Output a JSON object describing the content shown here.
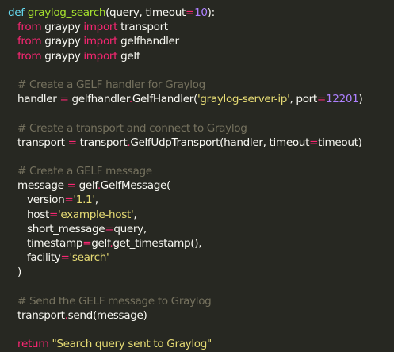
{
  "code": {
    "language": "python",
    "colors": {
      "background": "#272822",
      "text": "#f8f8f2",
      "keyword_def": "#66d9ef",
      "keyword_import": "#f92672",
      "function_name": "#a6e22e",
      "number": "#ae81ff",
      "string": "#e6db74",
      "comment": "#75715e",
      "operator": "#f92672"
    },
    "lines": [
      [
        {
          "t": "def",
          "c": "kw"
        },
        {
          "t": " ",
          "c": "plain"
        },
        {
          "t": "graylog_search",
          "c": "fn"
        },
        {
          "t": "(query, timeout",
          "c": "plain"
        },
        {
          "t": "=",
          "c": "op"
        },
        {
          "t": "10",
          "c": "num"
        },
        {
          "t": "):",
          "c": "plain"
        }
      ],
      [
        {
          "t": "from",
          "c": "kw2"
        },
        {
          "t": " graypy ",
          "c": "plain"
        },
        {
          "t": "import",
          "c": "kw2"
        },
        {
          "t": " transport",
          "c": "plain"
        }
      ],
      [
        {
          "t": "from",
          "c": "kw2"
        },
        {
          "t": " graypy ",
          "c": "plain"
        },
        {
          "t": "import",
          "c": "kw2"
        },
        {
          "t": " gelfhandler",
          "c": "plain"
        }
      ],
      [
        {
          "t": "from",
          "c": "kw2"
        },
        {
          "t": " graypy ",
          "c": "plain"
        },
        {
          "t": "import",
          "c": "kw2"
        },
        {
          "t": " gelf",
          "c": "plain"
        }
      ],
      [],
      [
        {
          "t": "# Create a GELF handler for Graylog",
          "c": "cmt"
        }
      ],
      [
        {
          "t": "handler ",
          "c": "plain"
        },
        {
          "t": "=",
          "c": "op"
        },
        {
          "t": " gelfhandler",
          "c": "plain"
        },
        {
          "t": ".",
          "c": "op"
        },
        {
          "t": "GelfHandler(",
          "c": "plain"
        },
        {
          "t": "'graylog-server-ip'",
          "c": "str"
        },
        {
          "t": ", port",
          "c": "plain"
        },
        {
          "t": "=",
          "c": "op"
        },
        {
          "t": "12201",
          "c": "num"
        },
        {
          "t": ")",
          "c": "plain"
        }
      ],
      [],
      [
        {
          "t": "# Create a transport and connect to Graylog",
          "c": "cmt"
        }
      ],
      [
        {
          "t": "transport ",
          "c": "plain"
        },
        {
          "t": "=",
          "c": "op"
        },
        {
          "t": " transport",
          "c": "plain"
        },
        {
          "t": ".",
          "c": "op"
        },
        {
          "t": "GelfUdpTransport(handler, timeout",
          "c": "plain"
        },
        {
          "t": "=",
          "c": "op"
        },
        {
          "t": "timeout)",
          "c": "plain"
        }
      ],
      [],
      [
        {
          "t": "# Create a GELF message",
          "c": "cmt"
        }
      ],
      [
        {
          "t": "message ",
          "c": "plain"
        },
        {
          "t": "=",
          "c": "op"
        },
        {
          "t": " gelf",
          "c": "plain"
        },
        {
          "t": ".",
          "c": "op"
        },
        {
          "t": "GelfMessage(",
          "c": "plain"
        }
      ],
      [
        {
          "t": "version",
          "c": "plain"
        },
        {
          "t": "=",
          "c": "op"
        },
        {
          "t": "'1.1'",
          "c": "str"
        },
        {
          "t": ",",
          "c": "plain"
        }
      ],
      [
        {
          "t": "host",
          "c": "plain"
        },
        {
          "t": "=",
          "c": "op"
        },
        {
          "t": "'example-host'",
          "c": "str"
        },
        {
          "t": ",",
          "c": "plain"
        }
      ],
      [
        {
          "t": "short_message",
          "c": "plain"
        },
        {
          "t": "=",
          "c": "op"
        },
        {
          "t": "query,",
          "c": "plain"
        }
      ],
      [
        {
          "t": "timestamp",
          "c": "plain"
        },
        {
          "t": "=",
          "c": "op"
        },
        {
          "t": "gelf",
          "c": "plain"
        },
        {
          "t": ".",
          "c": "op"
        },
        {
          "t": "get_timestamp(),",
          "c": "plain"
        }
      ],
      [
        {
          "t": "facility",
          "c": "plain"
        },
        {
          "t": "=",
          "c": "op"
        },
        {
          "t": "'search'",
          "c": "str"
        }
      ],
      [
        {
          "t": ")",
          "c": "plain"
        }
      ],
      [],
      [
        {
          "t": "# Send the GELF message to Graylog",
          "c": "cmt"
        }
      ],
      [
        {
          "t": "transport",
          "c": "plain"
        },
        {
          "t": ".",
          "c": "op"
        },
        {
          "t": "send(message)",
          "c": "plain"
        }
      ],
      [],
      [
        {
          "t": "return",
          "c": "kw2"
        },
        {
          "t": " ",
          "c": "plain"
        },
        {
          "t": "\"Search query sent to Graylog\"",
          "c": "str"
        }
      ]
    ]
  }
}
